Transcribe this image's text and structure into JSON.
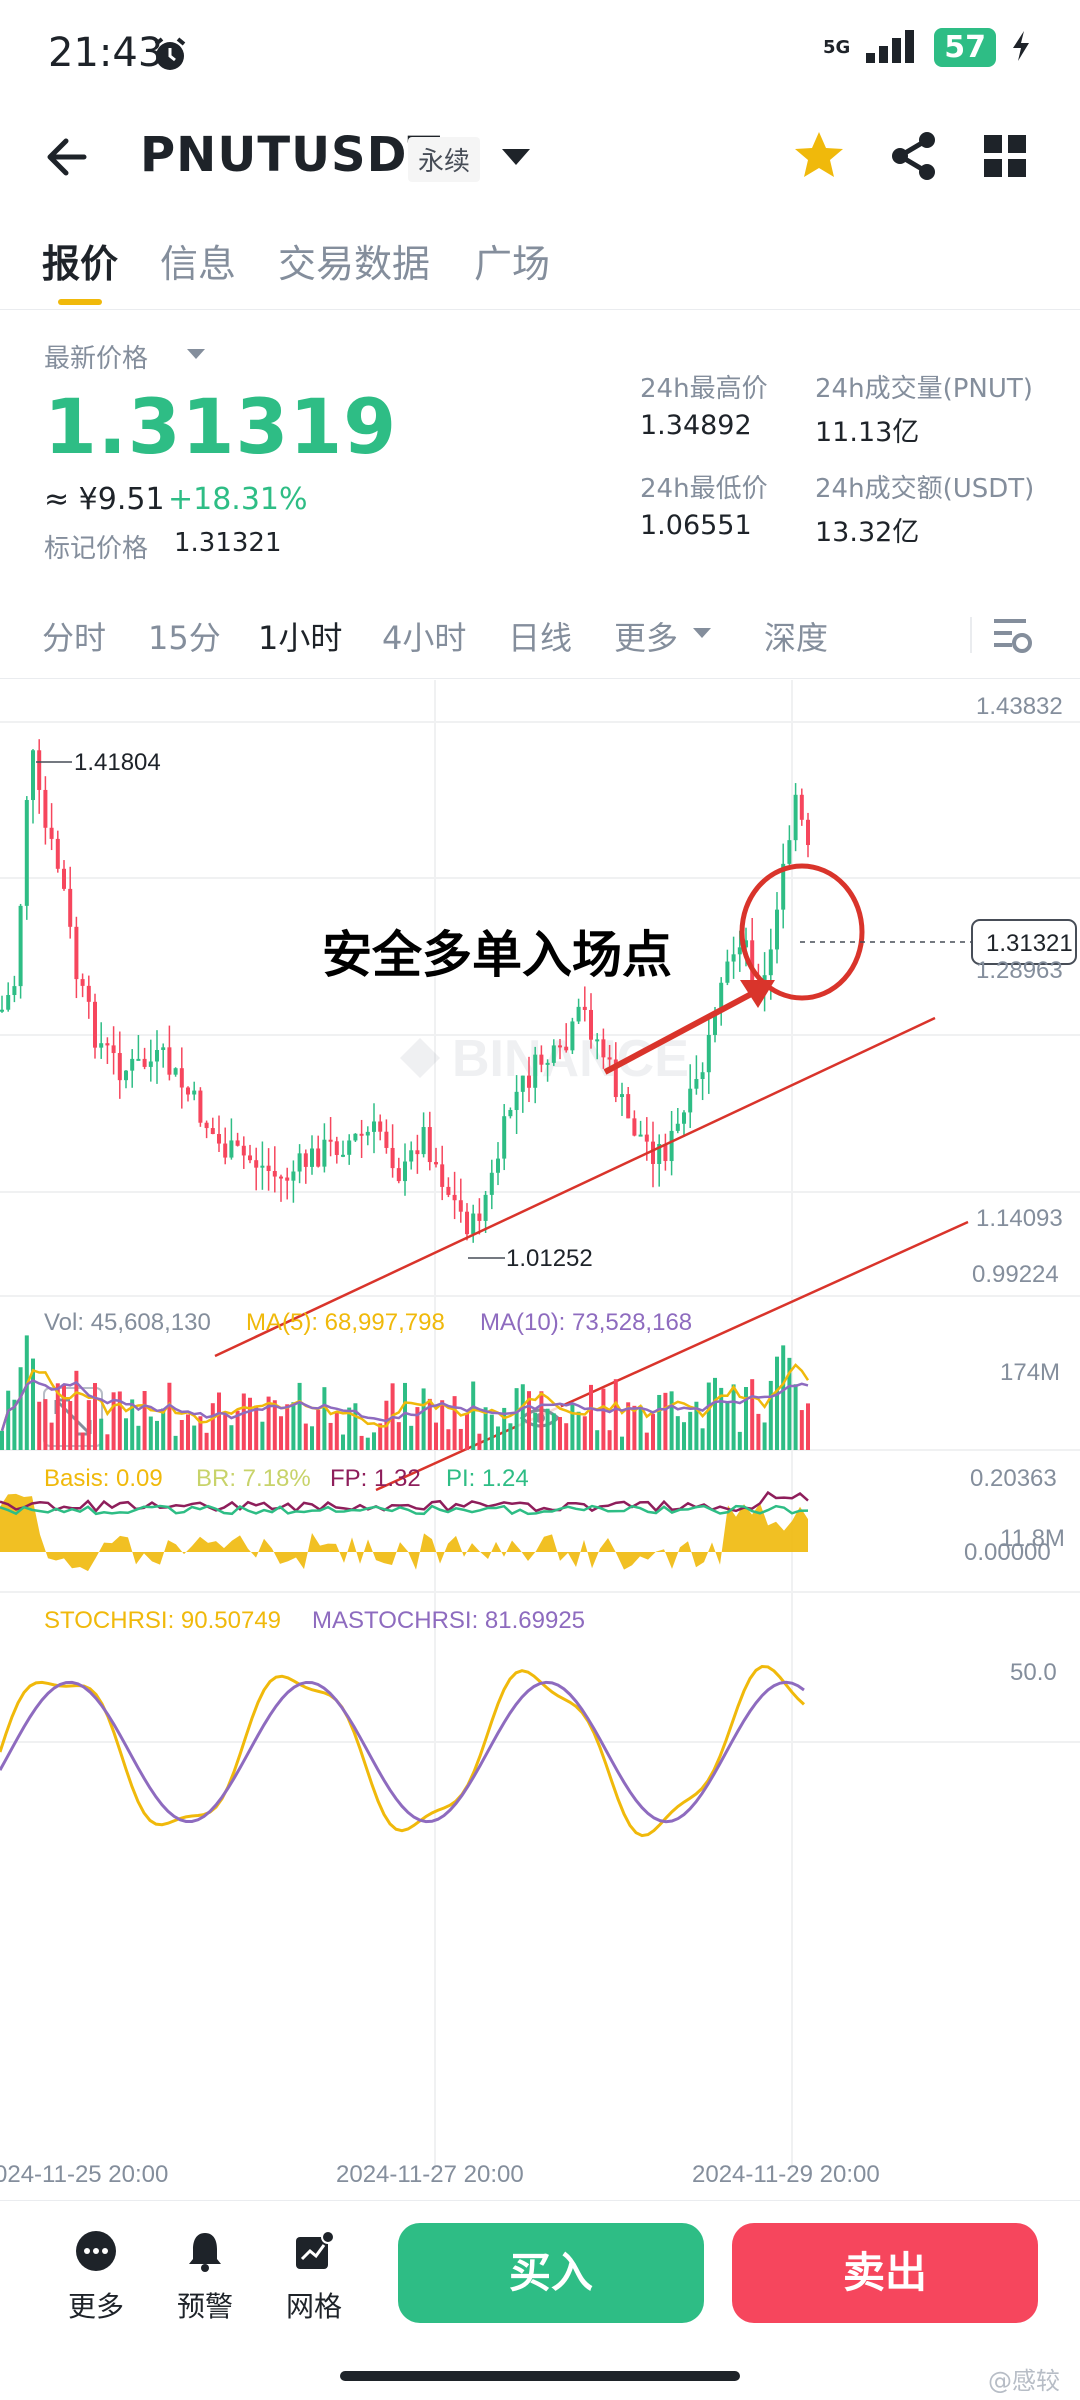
{
  "status": {
    "time": "21:43",
    "network": "5G",
    "battery": "57"
  },
  "header": {
    "symbol": "PNUTUSDT",
    "contract_type": "永续"
  },
  "tabs": [
    {
      "label": "报价"
    },
    {
      "label": "信息"
    },
    {
      "label": "交易数据"
    },
    {
      "label": "广场"
    }
  ],
  "price": {
    "last_label": "最新价格",
    "last": "1.31319",
    "cny": "≈ ¥9.51",
    "change": "+18.31%",
    "mark_label": "标记价格",
    "mark": "1.31321"
  },
  "stats": {
    "high_label": "24h最高价",
    "high": "1.34892",
    "vol_pnut_label": "24h成交量(PNUT)",
    "vol_pnut": "11.13亿",
    "low_label": "24h最低价",
    "low": "1.06551",
    "vol_usdt_label": "24h成交额(USDT)",
    "vol_usdt": "13.32亿"
  },
  "intervals": [
    {
      "label": "分时"
    },
    {
      "label": "15分"
    },
    {
      "label": "1小时"
    },
    {
      "label": "4小时"
    },
    {
      "label": "日线"
    },
    {
      "label": "更多"
    },
    {
      "label": "深度"
    }
  ],
  "chart": {
    "axis": [
      "1.43832",
      "1.28963",
      "1.14093",
      "0.99224"
    ],
    "current_price_tag": "1.31321",
    "max_label": "1.41804",
    "min_label": "1.01252",
    "annotation": "安全多单入场点",
    "logo": "BINANCE",
    "vol_label": "Vol: 45,608,130",
    "ma5_label": "MA(5): 68,997,798",
    "ma10_label": "MA(10): 73,528,168",
    "vol_axis_top": "174M",
    "vol_axis_bottom": "11.8M",
    "basis_label": "Basis: 0.09",
    "br_label": "BR: 7.18%",
    "fp_label": "FP: 1.32",
    "pi_label": "PI: 1.24",
    "basis_axis_top": "0.20363",
    "basis_axis_mid": "0.00000",
    "stoch_label": "STOCHRSI: 90.50749",
    "mastoch_label": "MASTOCHRSI: 81.69925",
    "stoch_axis": "50.0",
    "dates": [
      "024-11-25 20:00",
      "2024-11-27 20:00",
      "2024-11-29 20:00"
    ],
    "colors": {
      "up": "#2ebd85",
      "down": "#f6465d",
      "ma5": "#f0b90b",
      "ma10": "#8e6bbf",
      "annotation": "#d9342b"
    }
  },
  "bottom": {
    "more_label": "更多",
    "alert_label": "预警",
    "grid_label": "网格",
    "buy_label": "买入",
    "sell_label": "卖出",
    "watermark": "@感较"
  }
}
